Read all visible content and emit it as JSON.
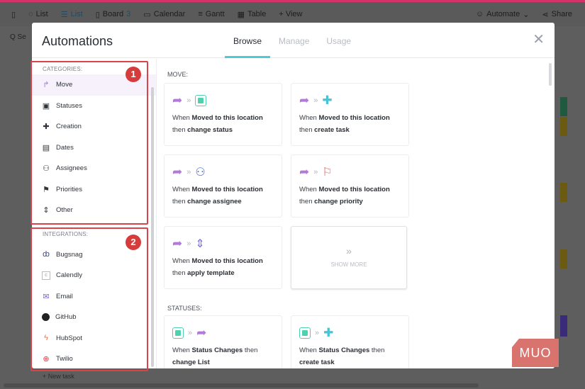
{
  "appbar": {
    "list_title": "List",
    "views": [
      "List",
      "Board",
      "Calendar",
      "Gantt",
      "Table",
      "+ View"
    ],
    "board_count": "3",
    "automate": "Automate",
    "share": "Share"
  },
  "search_stub": "Q Se",
  "new_task": "+ New task",
  "modal": {
    "title": "Automations",
    "tabs": [
      "Browse",
      "Manage",
      "Usage"
    ],
    "active_tab": "Browse",
    "close": "✕"
  },
  "sidebar": {
    "categories_label": "CATEGORIES:",
    "categories": [
      "Move",
      "Statuses",
      "Creation",
      "Dates",
      "Assignees",
      "Priorities",
      "Other"
    ],
    "selected": "Move",
    "integrations_label": "INTEGRATIONS:",
    "integrations": [
      "Bugsnag",
      "Calendly",
      "Email",
      "GitHub",
      "HubSpot",
      "Twilio"
    ]
  },
  "annotations": [
    "1",
    "2"
  ],
  "sections": {
    "move_label": "MOVE:",
    "statuses_label": "STATUSES:"
  },
  "cards": [
    {
      "when": "When ",
      "trigger": "Moved to this location",
      "then": "then ",
      "action": "change status"
    },
    {
      "when": "When ",
      "trigger": "Moved to this location",
      "then": "then ",
      "action": "create task"
    },
    {
      "when": "When ",
      "trigger": "Moved to this location",
      "then": "then ",
      "action": "change assignee"
    },
    {
      "when": "When ",
      "trigger": "Moved to this location",
      "then": "then ",
      "action": "change priority"
    },
    {
      "when": "When ",
      "trigger": "Moved to this location",
      "then": "then ",
      "action": "apply template"
    },
    {
      "when": "When ",
      "trigger": "Status Changes",
      "then": " then",
      "action": "change List"
    },
    {
      "when": "When ",
      "trigger": "Status Changes",
      "then": " then",
      "action": "create task"
    }
  ],
  "show_more": "SHOW MORE",
  "watermark": "MUO",
  "colors": {
    "accent": "#49ccd6",
    "annotation": "#d9434b",
    "move": "#b27ad6",
    "status": "#4fd1b0"
  }
}
